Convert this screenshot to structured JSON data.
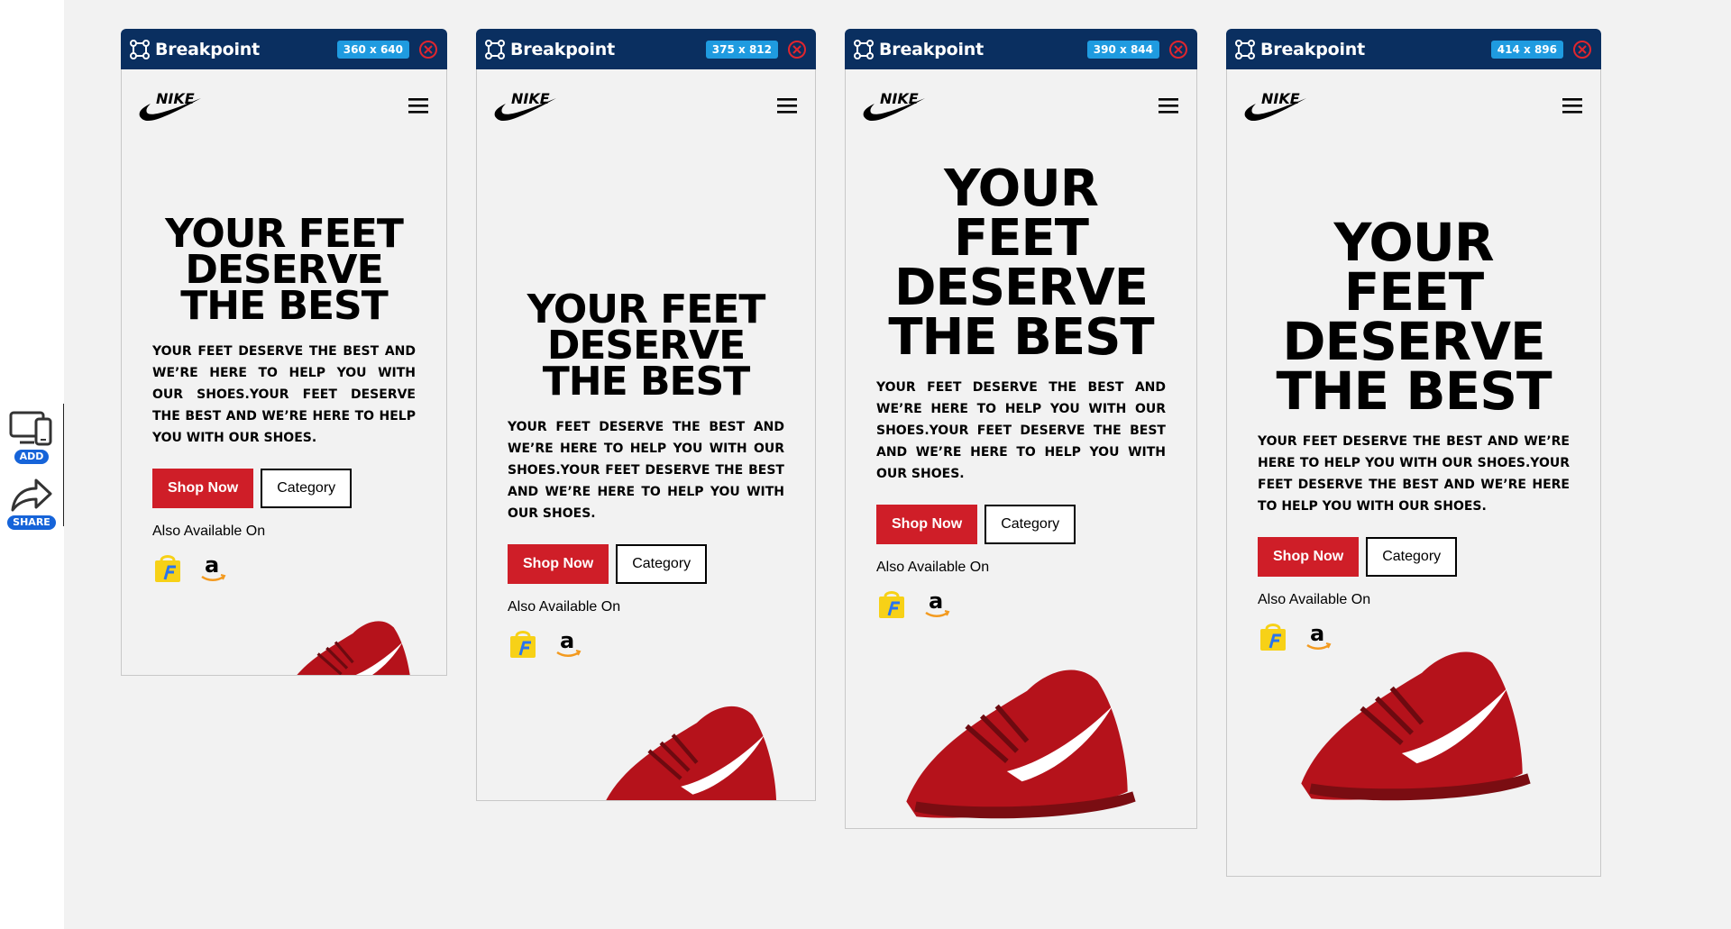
{
  "sidebar": {
    "add_label": "ADD",
    "share_label": "SHARE"
  },
  "colors": {
    "bar": "#0a2f60",
    "badge": "#1f9be0",
    "shop": "#cf1e28",
    "close": "#e0262e"
  },
  "frames": [
    {
      "title": "Breakpoint",
      "size": "360 x 640"
    },
    {
      "title": "Breakpoint",
      "size": "375 x 812"
    },
    {
      "title": "Breakpoint",
      "size": "390 x 844"
    },
    {
      "title": "Breakpoint",
      "size": "414 x 896"
    }
  ],
  "page": {
    "headline_lines": [
      "YOUR FEET",
      "DESERVE",
      "THE BEST"
    ],
    "headline_lines_narrow": [
      "YOUR",
      "FEET",
      "DESERVE",
      "THE BEST"
    ],
    "subtext": "YOUR FEET DESERVE THE BEST AND WE’RE HERE TO HELP YOU WITH OUR SHOES.YOUR FEET DESERVE THE BEST AND WE’RE HERE TO HELP YOU WITH OUR SHOES.",
    "shop_label": "Shop Now",
    "category_label": "Category",
    "available_label": "Also Available On",
    "stores": [
      "flipkart-icon",
      "amazon-icon"
    ],
    "logo": "nike-swoosh-logo",
    "menu_icon": "hamburger-menu-icon"
  }
}
